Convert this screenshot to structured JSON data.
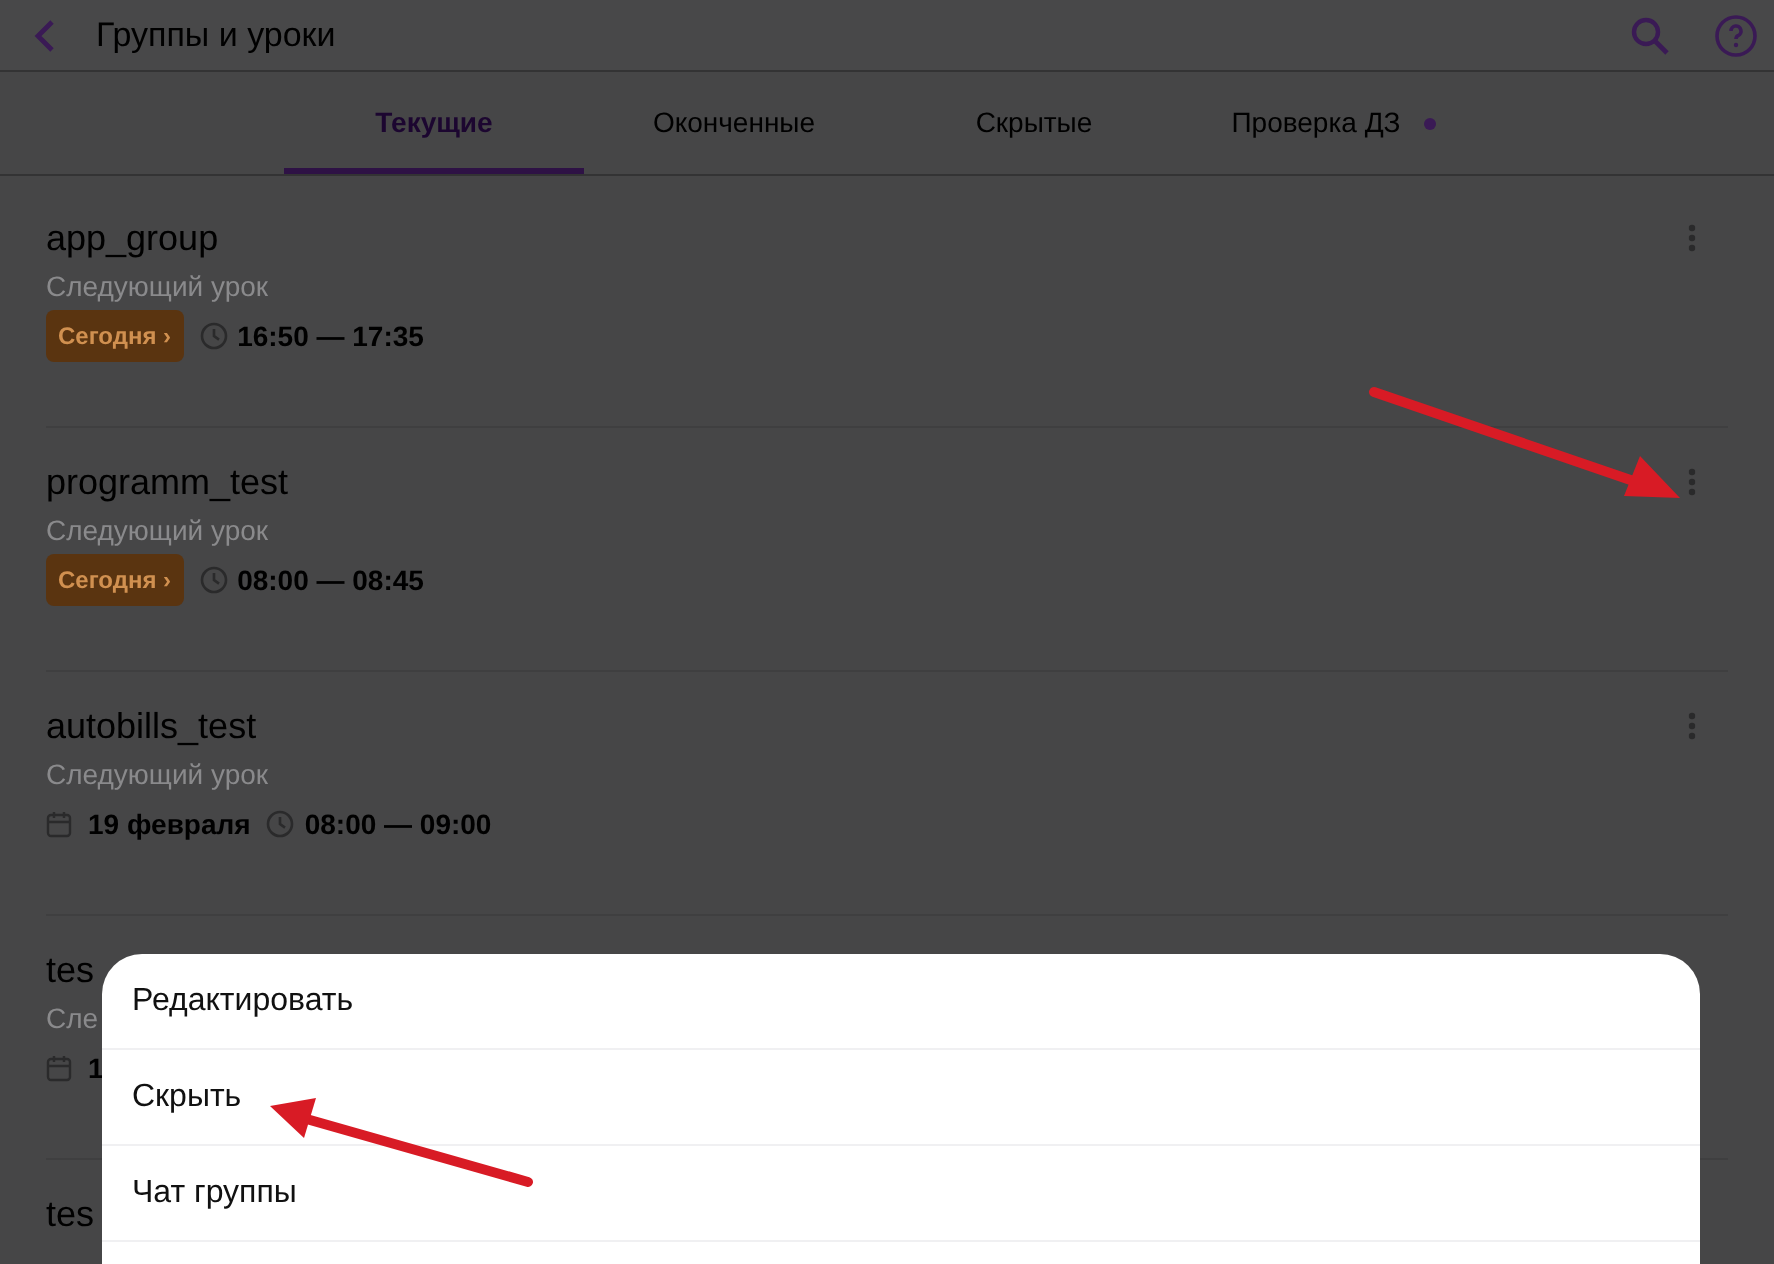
{
  "header": {
    "title": "Группы и уроки"
  },
  "tabs": [
    {
      "label": "Текущие",
      "selected": true,
      "dot": false
    },
    {
      "label": "Оконченные",
      "selected": false,
      "dot": false
    },
    {
      "label": "Скрытые",
      "selected": false,
      "dot": false
    },
    {
      "label": "Проверка ДЗ",
      "selected": false,
      "dot": true
    }
  ],
  "groups": [
    {
      "name": "app_group",
      "subtitle": "Следующий урок",
      "badge": "Сегодня ›",
      "time": "16:50 — 17:35"
    },
    {
      "name": "programm_test",
      "subtitle": "Следующий урок",
      "badge": "Сегодня ›",
      "time": "08:00 — 08:45"
    },
    {
      "name": "autobills_test",
      "subtitle": "Следующий урок",
      "date": "19 февраля",
      "time": "08:00 — 09:00"
    },
    {
      "name": "tes",
      "subtitle": "Сле",
      "date": "1"
    },
    {
      "name": "tes"
    }
  ],
  "menu": {
    "items": [
      "Редактировать",
      "Скрыть",
      "Чат группы"
    ]
  }
}
